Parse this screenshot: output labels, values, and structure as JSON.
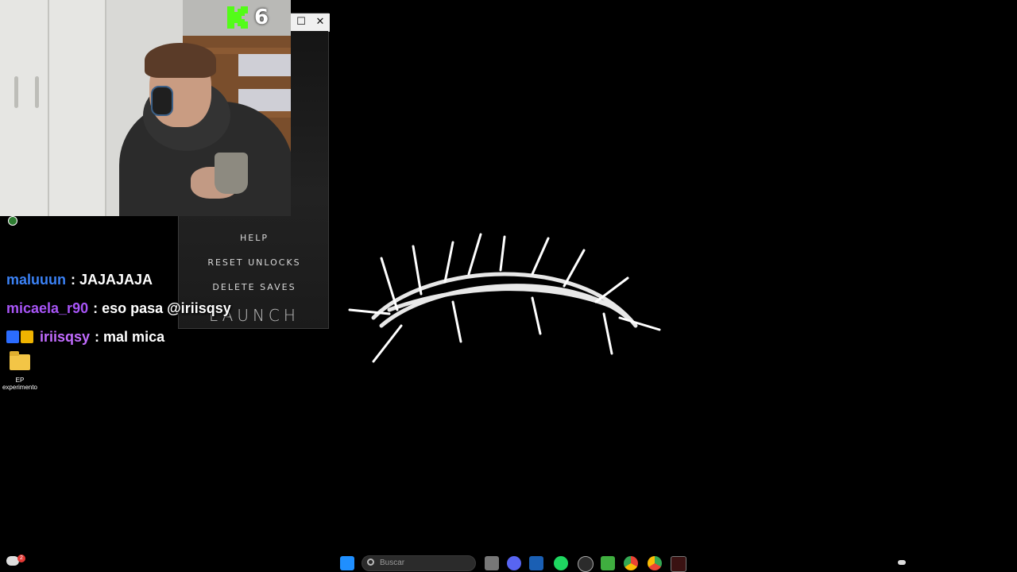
{
  "stream": {
    "viewer_count": "6",
    "brand_color": "#53fc18"
  },
  "launcher": {
    "menu": {
      "help": "HELP",
      "reset_unlocks": "RESET UNLOCKS",
      "delete_saves": "DELETE SAVES",
      "launch": "LAUNCH"
    },
    "close_symbol": "✕",
    "restore_symbol": "☐"
  },
  "chat": {
    "messages": [
      {
        "user": "maluuun",
        "text": ": JAJAJAJA",
        "color": "#3b82f6"
      },
      {
        "user": "micaela_r90",
        "text": ": eso pasa @iriisqsy",
        "color": "#a855f7"
      },
      {
        "user": "iriisqsy",
        "text": ": mal mica",
        "color": "#c26cff"
      }
    ]
  },
  "desktop": {
    "icons": [
      {
        "label": "EP experimento"
      }
    ]
  },
  "taskbar": {
    "search_placeholder": "Buscar",
    "notification_count": "2",
    "apps": [
      "start-icon",
      "file-icon",
      "discord-icon",
      "store-icon",
      "spotify-icon",
      "steam-icon",
      "minecraft-icon",
      "chrome-icon",
      "chrome-beta-icon",
      "game-icon"
    ]
  }
}
